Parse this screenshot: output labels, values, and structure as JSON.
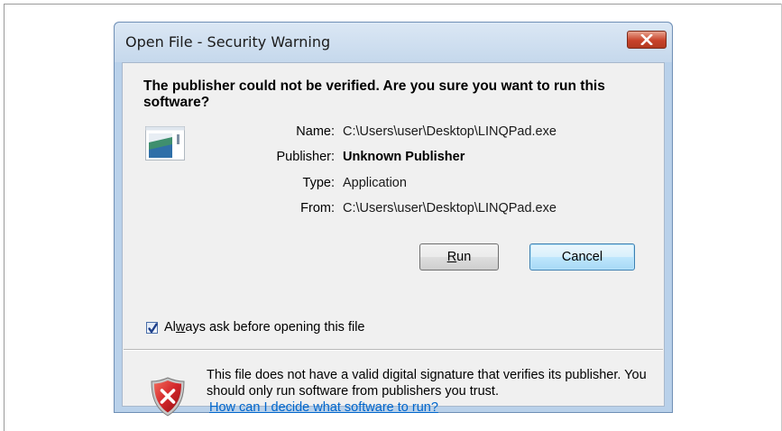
{
  "window": {
    "title": "Open File - Security Warning",
    "close_label": "Close"
  },
  "prompt": {
    "question": "The publisher could not be verified.  Are you sure you want to run this software?"
  },
  "details": {
    "name_label": "Name:",
    "name_value": "C:\\Users\\user\\Desktop\\LINQPad.exe",
    "publisher_label": "Publisher:",
    "publisher_value": "Unknown Publisher",
    "type_label": "Type:",
    "type_value": "Application",
    "from_label": "From:",
    "from_value": "C:\\Users\\user\\Desktop\\LINQPad.exe"
  },
  "buttons": {
    "run_prefix": "",
    "run_underlined": "R",
    "run_suffix": "un",
    "cancel": "Cancel"
  },
  "checkbox": {
    "checked": true,
    "label_prefix": "Al",
    "label_underlined": "w",
    "label_suffix": "ays ask before opening this file"
  },
  "warning": {
    "text": "This file does not have a valid digital signature that verifies its publisher.  You should only run software from publishers you trust.",
    "link": "How can I decide what software to run?"
  },
  "icons": {
    "app": "application-icon",
    "shield": "security-shield-error-icon",
    "close": "close-icon",
    "check": "checkmark-icon"
  },
  "colors": {
    "close_button": "#c8432a",
    "link": "#0066cc",
    "dialog_frame": "#b9d1ea"
  }
}
